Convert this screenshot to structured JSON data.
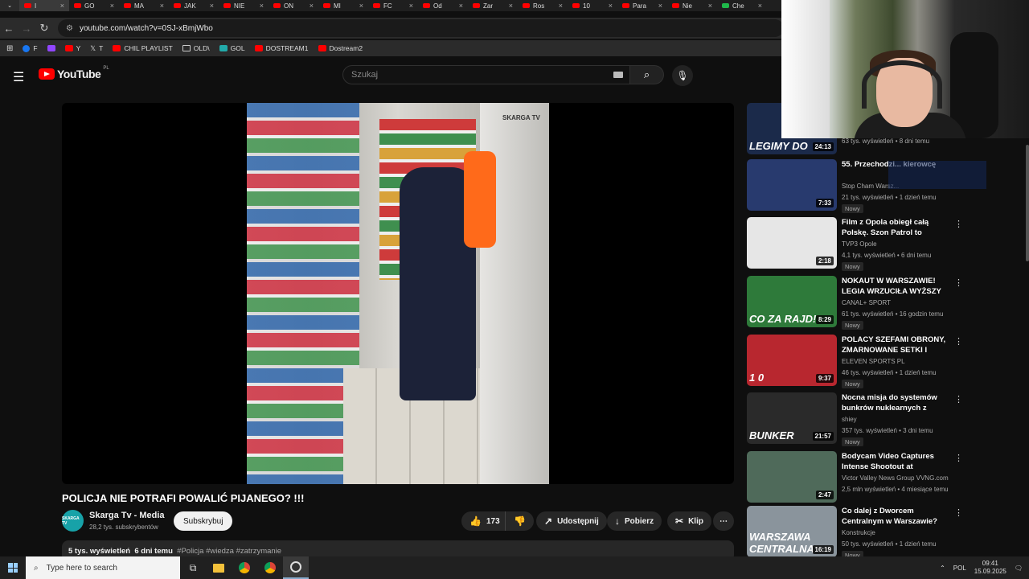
{
  "browser": {
    "tabs": [
      "I",
      "GO",
      "MA",
      "JAK",
      "NIE",
      "ON",
      "MI",
      "FC",
      "Od",
      "Zar",
      "Ros",
      "10",
      "Para",
      "Nie",
      "Che"
    ],
    "url": "youtube.com/watch?v=0SJ-xBmjWbo",
    "bookmarks": [
      "F",
      "Y",
      "T",
      "CHIL PLAYLIST",
      "OLD\\",
      "GOL",
      "DOSTREAM1",
      "Dostream2"
    ]
  },
  "youtube": {
    "logo_text": "YouTube",
    "region": "PL",
    "search_placeholder": "Szukaj"
  },
  "video": {
    "watermark": "SKARGA TV",
    "title": "POLICJA NIE POTRAFI POWALIĆ PIJANEGO? !!!",
    "channel": {
      "avatar_text": "SKARGA TV",
      "name": "Skarga Tv - Media",
      "subscribers": "28,2 tys. subskrybentów",
      "subscribe_label": "Subskrybuj"
    },
    "actions": {
      "likes": "173",
      "share": "Udostępnij",
      "download": "Pobierz",
      "clip": "Klip"
    },
    "description": {
      "views": "5 tys. wyświetleń",
      "date": "6 dni temu",
      "tags": "#Policja #wiedza #zatrzymanie"
    }
  },
  "recommendations": [
    {
      "title": "",
      "channel": "",
      "meta": "63 tys. wyświetleń • 8 dni temu",
      "duration": "24:13",
      "thumb_text": "LEGIMY DO",
      "badge": "",
      "thumb_color": "#1b2a4a"
    },
    {
      "title": "55. Przechodzi... kierowcę",
      "channel": "Stop Cham Warsz...",
      "meta": "21 tys. wyświetleń • 1 dzień temu",
      "duration": "7:33",
      "thumb_text": "",
      "badge": "Nowy",
      "thumb_color": "#283a6e"
    },
    {
      "title": "Film z Opola obiegł całą Polskę. Szon Patrol to zagrożenie ...",
      "channel": "TVP3 Opole",
      "meta": "4,1 tys. wyświetleń • 6 dni temu",
      "duration": "2:18",
      "thumb_text": "",
      "badge": "Nowy",
      "thumb_color": "#e6e6e6"
    },
    {
      "title": "NOKAUT W WARSZAWIE! LEGIA WRZUCIŁA WYŻSZY BIEGI ...",
      "channel": "CANAL+ SPORT",
      "meta": "61 tys. wyświetleń • 16 godzin temu",
      "duration": "8:29",
      "thumb_text": "CO ZA RAJD!",
      "badge": "Nowy",
      "thumb_color": "#2e7a3a"
    },
    {
      "title": "POLACY SZEFAMI OBRONY, ZMARNOWANE SETKI I UDAN...",
      "channel": "ELEVEN SPORTS PL",
      "meta": "46 tys. wyświetleń • 1 dzień temu",
      "duration": "9:37",
      "thumb_text": "1  0",
      "badge": "Nowy",
      "thumb_color": "#b8272f"
    },
    {
      "title": "Nocna misja do systemów bunkrów nuklearnych z czasó...",
      "channel": "shiey",
      "meta": "357 tys. wyświetleń • 3 dni temu",
      "duration": "21:57",
      "thumb_text": "BUNKER",
      "badge": "Nowy",
      "thumb_color": "#2a2a2a"
    },
    {
      "title": "Bodycam Video Captures Intense Shootout at Victorville...",
      "channel": "Victor Valley News Group VVNG.com",
      "meta": "2,5 mln wyświetleń • 4 miesiące temu",
      "duration": "2:47",
      "thumb_text": "",
      "badge": "",
      "thumb_color": "#4f6a5a"
    },
    {
      "title": "Co dalej z Dworcem Centralnym w Warszawie?",
      "channel": "Konstrukcje",
      "meta": "50 tys. wyświetleń • 1 dzień temu",
      "duration": "16:19",
      "thumb_text": "WARSZAWA CENTRALNA",
      "badge": "Nowy",
      "thumb_color": "#8a949c"
    }
  ],
  "taskbar": {
    "search_placeholder": "Type here to search",
    "language": "POL",
    "time": "09:41",
    "date": "15.09.2025"
  }
}
